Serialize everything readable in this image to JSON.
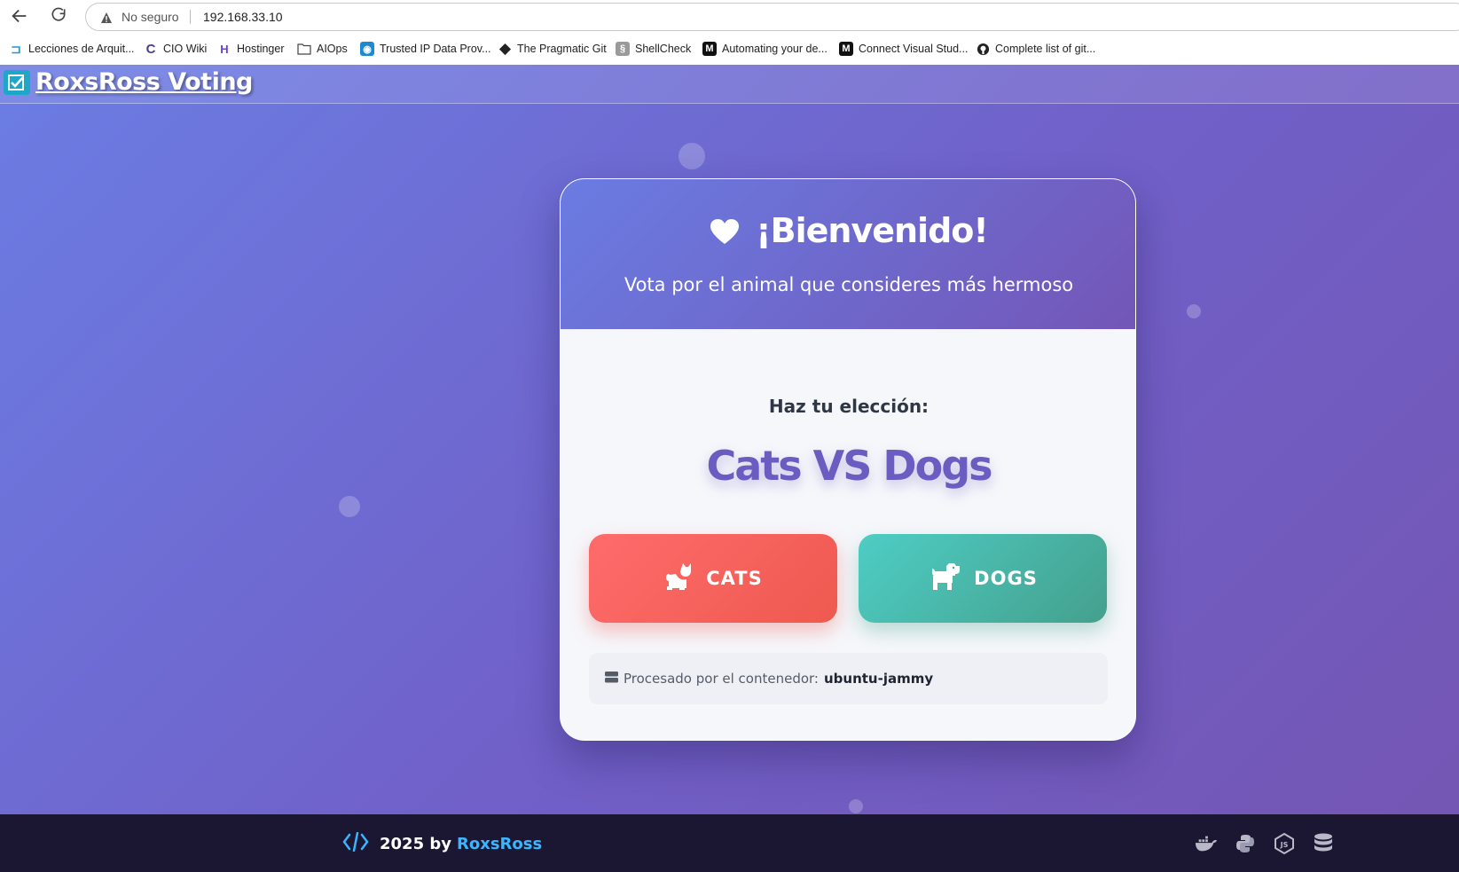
{
  "browser": {
    "security_label": "No seguro",
    "url": "192.168.33.10",
    "bookmarks": [
      {
        "label": "Lecciones de Arquit...",
        "icon": "bracket-icon"
      },
      {
        "label": "CIO Wiki",
        "icon": "c-icon"
      },
      {
        "label": "Hostinger",
        "icon": "hostinger-icon"
      },
      {
        "label": "AIOps",
        "icon": "folder-icon"
      },
      {
        "label": "Trusted IP Data Prov...",
        "icon": "location-icon"
      },
      {
        "label": "The Pragmatic Git",
        "icon": "git-icon"
      },
      {
        "label": "ShellCheck",
        "icon": "shellcheck-icon"
      },
      {
        "label": "Automating your de...",
        "icon": "medium-icon"
      },
      {
        "label": "Connect Visual Stud...",
        "icon": "medium-icon"
      },
      {
        "label": "Complete list of git...",
        "icon": "github-icon"
      }
    ]
  },
  "app": {
    "brand": "RoxsRoss Voting",
    "card": {
      "welcome": "¡Bienvenido!",
      "subtitle": "Vota por el animal que consideres más hermoso",
      "choice_label": "Haz tu elección:",
      "vs_title": "Cats VS Dogs",
      "cats_label": "CATS",
      "dogs_label": "DOGS",
      "processed_label": "Procesado por el contenedor:",
      "container_name": "ubuntu-jammy"
    },
    "footer": {
      "year_by": "2025 by",
      "author": "RoxsRoss",
      "icons": [
        "docker-icon",
        "python-icon",
        "nodejs-icon",
        "database-icon"
      ]
    }
  },
  "colors": {
    "cats": "#ff6b6b",
    "dogs": "#4ecdc4",
    "accent": "#6a5cc0",
    "footer_bg": "#1b1733",
    "footer_link": "#39b6ff"
  }
}
